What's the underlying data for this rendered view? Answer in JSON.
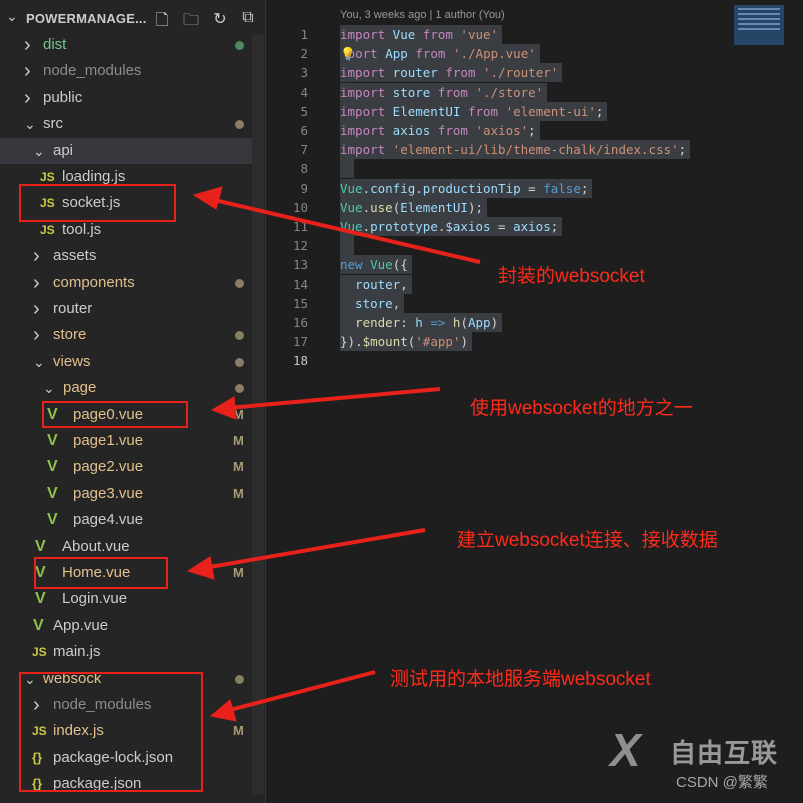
{
  "explorer": {
    "title": "POWERMANAGE...",
    "actions": [
      {
        "name": "new-file-icon",
        "glyph": "🗋"
      },
      {
        "name": "new-folder-icon",
        "glyph": "🗀"
      },
      {
        "name": "refresh-icon",
        "glyph": "↻"
      },
      {
        "name": "collapse-all-icon",
        "glyph": "⧉"
      }
    ],
    "tree": [
      {
        "label": "dist",
        "type": "folder",
        "open": false,
        "depth": 0,
        "status": "new",
        "dot": "#4e8a5b"
      },
      {
        "label": "node_modules",
        "type": "folder",
        "open": false,
        "depth": 0,
        "status": "ign"
      },
      {
        "label": "public",
        "type": "folder",
        "open": false,
        "depth": 0,
        "status": "def"
      },
      {
        "label": "src",
        "type": "folder",
        "open": true,
        "depth": 0,
        "status": "def",
        "dot": "#8a7d65"
      },
      {
        "label": "api",
        "type": "folder",
        "open": true,
        "depth": 1,
        "status": "def",
        "selected": true
      },
      {
        "label": "loading.js",
        "type": "js",
        "depth": 2,
        "status": "def"
      },
      {
        "label": "socket.js",
        "type": "js",
        "depth": 2,
        "status": "def"
      },
      {
        "label": "tool.js",
        "type": "js",
        "depth": 2,
        "status": "def"
      },
      {
        "label": "assets",
        "type": "folder",
        "open": false,
        "depth": 1,
        "status": "def"
      },
      {
        "label": "components",
        "type": "folder",
        "open": false,
        "depth": 1,
        "status": "mod",
        "dot": "#8a7d65"
      },
      {
        "label": "router",
        "type": "folder",
        "open": false,
        "depth": 1,
        "status": "def"
      },
      {
        "label": "store",
        "type": "folder",
        "open": false,
        "depth": 1,
        "status": "mod",
        "dot": "#8a7d65"
      },
      {
        "label": "views",
        "type": "folder",
        "open": true,
        "depth": 1,
        "status": "mod",
        "dot": "#8a7d65"
      },
      {
        "label": "page",
        "type": "folder",
        "open": true,
        "depth": 2,
        "status": "mod",
        "dot": "#8a7d65"
      },
      {
        "label": "page0.vue",
        "type": "vue",
        "depth": 3,
        "status": "mod",
        "badge": "M"
      },
      {
        "label": "page1.vue",
        "type": "vue",
        "depth": 3,
        "status": "mod",
        "badge": "M"
      },
      {
        "label": "page2.vue",
        "type": "vue",
        "depth": 3,
        "status": "mod",
        "badge": "M"
      },
      {
        "label": "page3.vue",
        "type": "vue",
        "depth": 3,
        "status": "mod",
        "badge": "M"
      },
      {
        "label": "page4.vue",
        "type": "vue",
        "depth": 3,
        "status": "def"
      },
      {
        "label": "About.vue",
        "type": "vue",
        "depth": 2,
        "status": "def"
      },
      {
        "label": "Home.vue",
        "type": "vue",
        "depth": 2,
        "status": "mod",
        "badge": "M"
      },
      {
        "label": "Login.vue",
        "type": "vue",
        "depth": 2,
        "status": "def"
      },
      {
        "label": "App.vue",
        "type": "vue",
        "depth": 1,
        "status": "def"
      },
      {
        "label": "main.js",
        "type": "js",
        "depth": 1,
        "status": "def"
      },
      {
        "label": "websock",
        "type": "folder",
        "open": true,
        "depth": 0,
        "status": "mod",
        "dot": "#8a7d65"
      },
      {
        "label": "node_modules",
        "type": "folder",
        "open": false,
        "depth": 1,
        "status": "ign"
      },
      {
        "label": "index.js",
        "type": "js",
        "depth": 1,
        "status": "mod",
        "badge": "M"
      },
      {
        "label": "package-lock.json",
        "type": "json",
        "depth": 1,
        "status": "def"
      },
      {
        "label": "package.json",
        "type": "json",
        "depth": 1,
        "status": "def"
      }
    ]
  },
  "editor": {
    "blame": "You, 3 weeks ago | 1 author (You)",
    "current_line": 18,
    "lines": [
      [
        [
          "import",
          "kw"
        ],
        [
          " Vue ",
          "id"
        ],
        [
          "from",
          "kw"
        ],
        [
          " 'vue'",
          "str"
        ]
      ],
      [
        [
          "💡",
          "p"
        ],
        [
          "port",
          "kw"
        ],
        [
          " App ",
          "id"
        ],
        [
          "from",
          "kw"
        ],
        [
          " './App.vue'",
          "str"
        ]
      ],
      [
        [
          "import",
          "kw"
        ],
        [
          " router ",
          "id"
        ],
        [
          "from",
          "kw"
        ],
        [
          " './router'",
          "str"
        ]
      ],
      [
        [
          "import",
          "kw"
        ],
        [
          " store ",
          "id"
        ],
        [
          "from",
          "kw"
        ],
        [
          " './store'",
          "str"
        ]
      ],
      [
        [
          "import",
          "kw"
        ],
        [
          " ElementUI ",
          "id"
        ],
        [
          "from",
          "kw"
        ],
        [
          " 'element-ui'",
          "str"
        ],
        [
          ";",
          "p"
        ]
      ],
      [
        [
          "import",
          "kw"
        ],
        [
          " axios ",
          "id"
        ],
        [
          "from",
          "kw"
        ],
        [
          " 'axios'",
          "str"
        ],
        [
          ";",
          "p"
        ]
      ],
      [
        [
          "import",
          "kw"
        ],
        [
          " 'element-ui/lib/theme-chalk/index.css'",
          "str"
        ],
        [
          ";",
          "p"
        ]
      ],
      [],
      [
        [
          "Vue",
          "cls"
        ],
        [
          ".",
          "p"
        ],
        [
          "config",
          "id"
        ],
        [
          ".",
          "p"
        ],
        [
          "productionTip",
          "id"
        ],
        [
          " = ",
          "p"
        ],
        [
          "false",
          "bool"
        ],
        [
          ";",
          "p"
        ]
      ],
      [
        [
          "Vue",
          "cls"
        ],
        [
          ".",
          "p"
        ],
        [
          "use",
          "fn"
        ],
        [
          "(",
          "p"
        ],
        [
          "ElementUI",
          "id"
        ],
        [
          ");",
          "p"
        ]
      ],
      [
        [
          "Vue",
          "cls"
        ],
        [
          ".",
          "p"
        ],
        [
          "prototype",
          "id"
        ],
        [
          ".",
          "p"
        ],
        [
          "$axios",
          "id"
        ],
        [
          " = ",
          "p"
        ],
        [
          "axios",
          "id"
        ],
        [
          ";",
          "p"
        ]
      ],
      [],
      [
        [
          "new",
          "bool"
        ],
        [
          " ",
          "p"
        ],
        [
          "Vue",
          "cls"
        ],
        [
          "({",
          "p"
        ]
      ],
      [
        [
          "  router",
          "id"
        ],
        [
          ",",
          "p"
        ]
      ],
      [
        [
          "  store",
          "id"
        ],
        [
          ",",
          "p"
        ]
      ],
      [
        [
          "  render",
          "fn"
        ],
        [
          ": ",
          "p"
        ],
        [
          "h",
          "id"
        ],
        [
          " => ",
          "bool"
        ],
        [
          "h",
          "fn"
        ],
        [
          "(",
          "p"
        ],
        [
          "App",
          "id"
        ],
        [
          ")",
          "p"
        ]
      ],
      [
        [
          "})",
          "p"
        ],
        [
          ".",
          "p"
        ],
        [
          "$mount",
          "fn"
        ],
        [
          "(",
          "p"
        ],
        [
          "'#app'",
          "str"
        ],
        [
          ")",
          "p"
        ]
      ],
      null
    ]
  },
  "annotations": [
    {
      "text": "封装的websocket",
      "color": "#ff2a1a"
    },
    {
      "text": "使用websocket的地方之一",
      "color": "#ff2a1a"
    },
    {
      "text": "建立websocket连接、接收数据",
      "color": "#ff2a1a"
    },
    {
      "text": "测试用的本地服务端websocket",
      "color": "#ff2a1a"
    }
  ],
  "watermark": {
    "brand": "自由互联",
    "sub": "CSDN @繁繁"
  }
}
